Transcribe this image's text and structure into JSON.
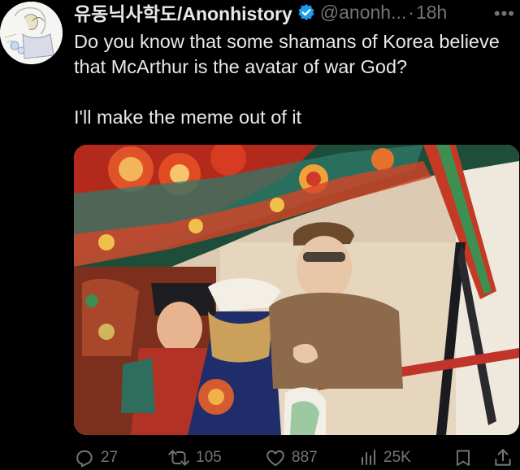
{
  "tweet": {
    "display_name": "유동닉사학도/Anonhistory",
    "handle": "@anonh...",
    "separator": "·",
    "time": "18h",
    "more_label": "•••",
    "text_line1": "Do you know that some shamans of Korea believe that McArthur is the avatar of war God?",
    "text_line2": "I'll make the meme out of it"
  },
  "actions": {
    "replies": "27",
    "reposts": "105",
    "likes": "887",
    "views": "25K"
  },
  "colors": {
    "text": "#e7e9ea",
    "muted": "#71767b",
    "verified": "#1d9bf0",
    "background": "#000000"
  },
  "icons": [
    "verified-badge-icon",
    "more-icon",
    "reply-icon",
    "repost-icon",
    "like-icon",
    "views-icon",
    "bookmark-icon",
    "share-icon"
  ]
}
